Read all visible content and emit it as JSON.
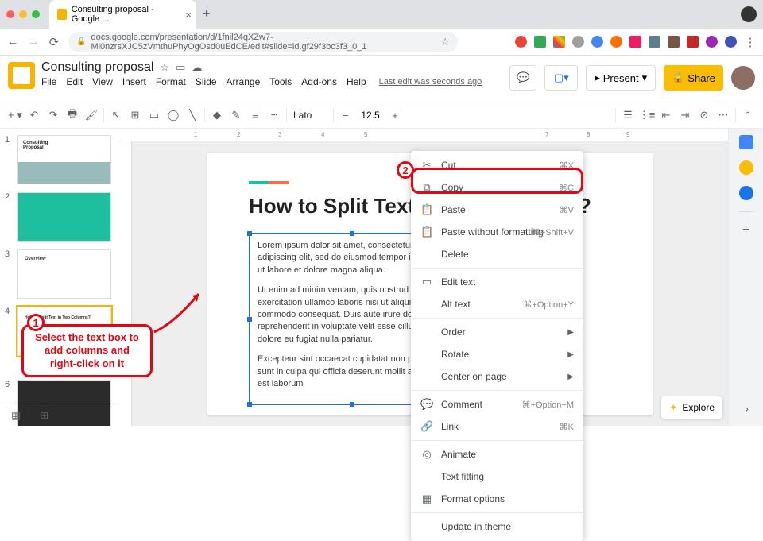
{
  "browser": {
    "tab_title": "Consulting proposal - Google ...",
    "url": "docs.google.com/presentation/d/1fnil24qXZw7-Ml0nzrsXJC5zVmthuPhyOgOsd0uEdCE/edit#slide=id.gf29f3bc3f3_0_1"
  },
  "doc": {
    "title": "Consulting proposal",
    "last_edit": "Last edit was seconds ago"
  },
  "menus": [
    "File",
    "Edit",
    "View",
    "Insert",
    "Format",
    "Slide",
    "Arrange",
    "Tools",
    "Add-ons",
    "Help"
  ],
  "header_buttons": {
    "present": "Present",
    "share": "Share"
  },
  "toolbar": {
    "font": "Lato",
    "fontsize": "12.5",
    "zoom": "—"
  },
  "slide": {
    "title": "How to Split Text in Two Columns?",
    "para1": "Lorem ipsum dolor sit amet, consectetur adipiscing elit, sed do eiusmod tempor incididunt ut labore et dolore magna aliqua.",
    "para2": "Ut enim ad minim veniam, quis nostrud exercitation ullamco laboris nisi ut aliquip ex ea commodo consequat. Duis aute irure dolor in reprehenderit in voluptate velit esse cillum dolore eu fugiat nulla pariatur.",
    "para3": "Excepteur sint occaecat cupidatat non proident, sunt in culpa qui officia deserunt mollit anim id est laborum"
  },
  "ctx": {
    "cut": {
      "label": "Cut",
      "sc": "⌘X"
    },
    "copy": {
      "label": "Copy",
      "sc": "⌘C"
    },
    "paste": {
      "label": "Paste",
      "sc": "⌘V"
    },
    "paste_wo": {
      "label": "Paste without formatting",
      "sc": "⌘+Shift+V"
    },
    "delete": {
      "label": "Delete"
    },
    "edit_text": {
      "label": "Edit text"
    },
    "alt_text": {
      "label": "Alt text",
      "sc": "⌘+Option+Y"
    },
    "order": {
      "label": "Order"
    },
    "rotate": {
      "label": "Rotate"
    },
    "center": {
      "label": "Center on page"
    },
    "comment": {
      "label": "Comment",
      "sc": "⌘+Option+M"
    },
    "link": {
      "label": "Link",
      "sc": "⌘K"
    },
    "animate": {
      "label": "Animate"
    },
    "text_fitting": {
      "label": "Text fitting"
    },
    "format_options": {
      "label": "Format options"
    },
    "update_theme": {
      "label": "Update in theme"
    }
  },
  "thumbs": {
    "t1_a": "Consulting",
    "t1_b": "Proposal",
    "t3": "Overview",
    "t4": "How to Split Text in Two Columns?"
  },
  "annot": {
    "step1": "Select the text box to add columns and right-click on it",
    "m1": "1",
    "m2": "2"
  },
  "explore": "Explore"
}
